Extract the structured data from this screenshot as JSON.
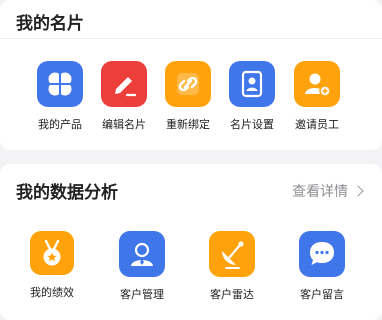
{
  "card_profile": {
    "title": "我的名片",
    "items": [
      {
        "label": "我的产品",
        "icon": "clover-icon",
        "color": "#3f76ea"
      },
      {
        "label": "编辑名片",
        "icon": "edit-pencil-icon",
        "color": "#ec3f3b"
      },
      {
        "label": "重新绑定",
        "icon": "link-icon",
        "color": "#ffa20c"
      },
      {
        "label": "名片设置",
        "icon": "contact-card-icon",
        "color": "#3f76ea"
      },
      {
        "label": "邀请员工",
        "icon": "add-user-icon",
        "color": "#ffa20c"
      }
    ]
  },
  "card_analysis": {
    "title": "我的数据分析",
    "more_label": "查看详情",
    "items": [
      {
        "label": "我的绩效",
        "icon": "medal-icon",
        "color": "#ffa20c"
      },
      {
        "label": "客户管理",
        "icon": "person-icon",
        "color": "#3f76ea"
      },
      {
        "label": "客户雷达",
        "icon": "radar-icon",
        "color": "#ffa20c"
      },
      {
        "label": "客户留言",
        "icon": "chat-bubble-icon",
        "color": "#3f76ea"
      }
    ]
  }
}
